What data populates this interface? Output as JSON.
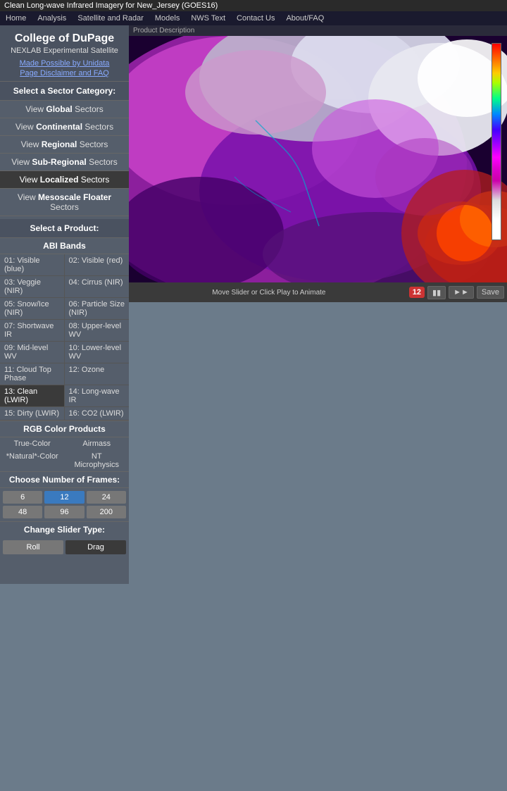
{
  "titleBar": {
    "text": "Clean Long-wave Infrared Imagery for New_Jersey (GOES16)"
  },
  "navBar": {
    "items": [
      {
        "label": "Home",
        "id": "home"
      },
      {
        "label": "Analysis",
        "id": "analysis"
      },
      {
        "label": "Satellite and Radar",
        "id": "satellite-radar"
      },
      {
        "label": "Models",
        "id": "models"
      },
      {
        "label": "NWS Text",
        "id": "nws-text"
      },
      {
        "label": "Contact Us",
        "id": "contact"
      },
      {
        "label": "About/FAQ",
        "id": "about"
      }
    ]
  },
  "sidebar": {
    "collegeName": "College of DuPage",
    "nexlabTitle": "NEXLAB Experimental Satellite",
    "unidataLink": "Made Possible by Unidata",
    "disclaimerLink": "Page Disclaimer and FAQ",
    "sectorCategoryLabel": "Select a Sector Category:",
    "sectorLinks": [
      {
        "label": "View ",
        "bold": "Global",
        "suffix": " Sectors",
        "id": "global",
        "active": false
      },
      {
        "label": "View ",
        "bold": "Continental",
        "suffix": " Sectors",
        "id": "continental",
        "active": false
      },
      {
        "label": "View ",
        "bold": "Regional",
        "suffix": " Sectors",
        "id": "regional",
        "active": false
      },
      {
        "label": "View ",
        "bold": "Sub-Regional",
        "suffix": " Sectors",
        "id": "subregional",
        "active": false
      },
      {
        "label": "View ",
        "bold": "Localized",
        "suffix": " Sectors",
        "id": "localized",
        "active": true
      },
      {
        "label": "View ",
        "bold": "Mesoscale Floater",
        "suffix": " Sectors",
        "id": "mesoscale",
        "active": false
      }
    ],
    "productLabel": "Select a Product:",
    "abiBandsLabel": "ABI Bands",
    "bands": [
      {
        "id": "01",
        "label": "01: Visible (blue)",
        "active": false
      },
      {
        "id": "02",
        "label": "02: Visible (red)",
        "active": false
      },
      {
        "id": "03",
        "label": "03: Veggie (NIR)",
        "active": false
      },
      {
        "id": "04",
        "label": "04: Cirrus (NIR)",
        "active": false
      },
      {
        "id": "05",
        "label": "05: Snow/Ice (NIR)",
        "active": false
      },
      {
        "id": "06",
        "label": "06: Particle Size (NIR)",
        "active": false
      },
      {
        "id": "07",
        "label": "07: Shortwave IR",
        "active": false
      },
      {
        "id": "08",
        "label": "08: Upper-level WV",
        "active": false
      },
      {
        "id": "09",
        "label": "09: Mid-level WV",
        "active": false
      },
      {
        "id": "10",
        "label": "10: Lower-level WV",
        "active": false
      },
      {
        "id": "11",
        "label": "11: Cloud Top Phase",
        "active": false
      },
      {
        "id": "12",
        "label": "12: Ozone",
        "active": false
      },
      {
        "id": "13",
        "label": "13: Clean (LWIR)",
        "active": true
      },
      {
        "id": "14",
        "label": "14: Long-wave IR",
        "active": false
      },
      {
        "id": "15",
        "label": "15: Dirty (LWIR)",
        "active": false
      },
      {
        "id": "16",
        "label": "16: CO2 (LWIR)",
        "active": false
      }
    ],
    "rgbLabel": "RGB Color Products",
    "rgbProducts": [
      {
        "label": "True-Color",
        "id": "true-color"
      },
      {
        "label": "Airmass",
        "id": "airmass"
      },
      {
        "label": "*Natural*-Color",
        "id": "natural-color"
      },
      {
        "label": "NT Microphysics",
        "id": "nt-microphysics"
      }
    ],
    "framesLabel": "Choose Number of Frames:",
    "frameOptions": [
      {
        "value": "6",
        "active": false
      },
      {
        "value": "12",
        "active": true
      },
      {
        "value": "24",
        "active": false
      },
      {
        "value": "48",
        "active": false
      },
      {
        "value": "96",
        "active": false
      },
      {
        "value": "200",
        "active": false
      }
    ],
    "sliderLabel": "Change Slider Type:",
    "sliderOptions": [
      {
        "label": "Roll",
        "active": false
      },
      {
        "label": "Drag",
        "active": true
      }
    ]
  },
  "animationBar": {
    "text": "Move Slider or Click Play to Animate",
    "frameCount": "12",
    "saveLabel": "Save"
  },
  "imageHeader": {
    "text": "Product Description"
  }
}
